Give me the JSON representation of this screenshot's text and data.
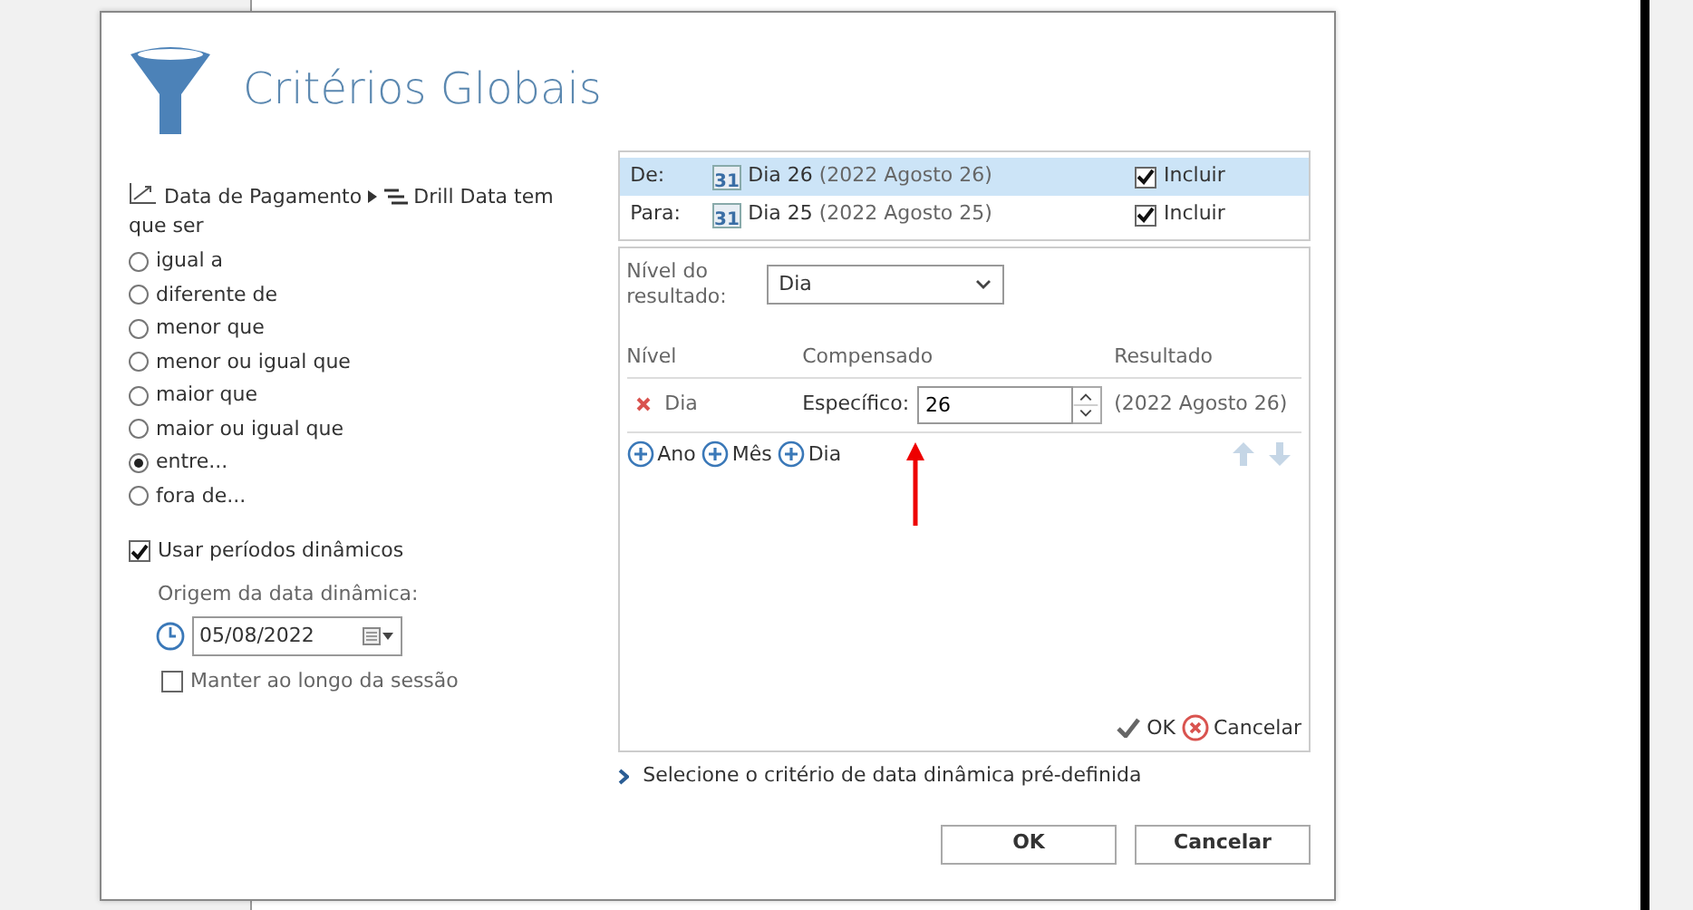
{
  "dialog": {
    "title": "Critérios Globais"
  },
  "criterion": {
    "field": "Data de Pagamento",
    "drill": "Drill Data tem que ser"
  },
  "operators": [
    {
      "label": "igual a",
      "selected": false
    },
    {
      "label": "diferente de",
      "selected": false
    },
    {
      "label": "menor que",
      "selected": false
    },
    {
      "label": "menor ou igual que",
      "selected": false
    },
    {
      "label": "maior que",
      "selected": false
    },
    {
      "label": "maior ou igual que",
      "selected": false
    },
    {
      "label": "entre...",
      "selected": true
    },
    {
      "label": "fora de...",
      "selected": false
    }
  ],
  "dynamic": {
    "label": "Usar períodos dinâmicos",
    "checked": true,
    "origin_label": "Origem da data dinâmica:",
    "origin_date": "05/08/2022",
    "keep_label": "Manter ao longo da sessão",
    "keep_checked": false
  },
  "range_rows": [
    {
      "label": "De:",
      "icon_text": "31",
      "value": "Dia 26",
      "detail": "(2022 Agosto 26)",
      "include_label": "Incluir",
      "include": true,
      "selected": true
    },
    {
      "label": "Para:",
      "icon_text": "31",
      "value": "Dia 25",
      "detail": "(2022 Agosto 25)",
      "include_label": "Incluir",
      "include": true,
      "selected": false
    }
  ],
  "editor": {
    "level_label": "Nível do resultado:",
    "level_value": "Dia",
    "columns": [
      "Nível",
      "Compensado",
      "Resultado"
    ],
    "rows": [
      {
        "level": "Dia",
        "offset_label": "Específico:",
        "offset_value": "26",
        "result": "(2022 Agosto 26)"
      }
    ],
    "add_buttons": [
      "Ano",
      "Mês",
      "Dia"
    ],
    "ok": "OK",
    "cancel": "Cancelar"
  },
  "predefined_link": "Selecione o critério de data dinâmica pré-definida",
  "buttons": [
    "OK",
    "Cancelar"
  ]
}
